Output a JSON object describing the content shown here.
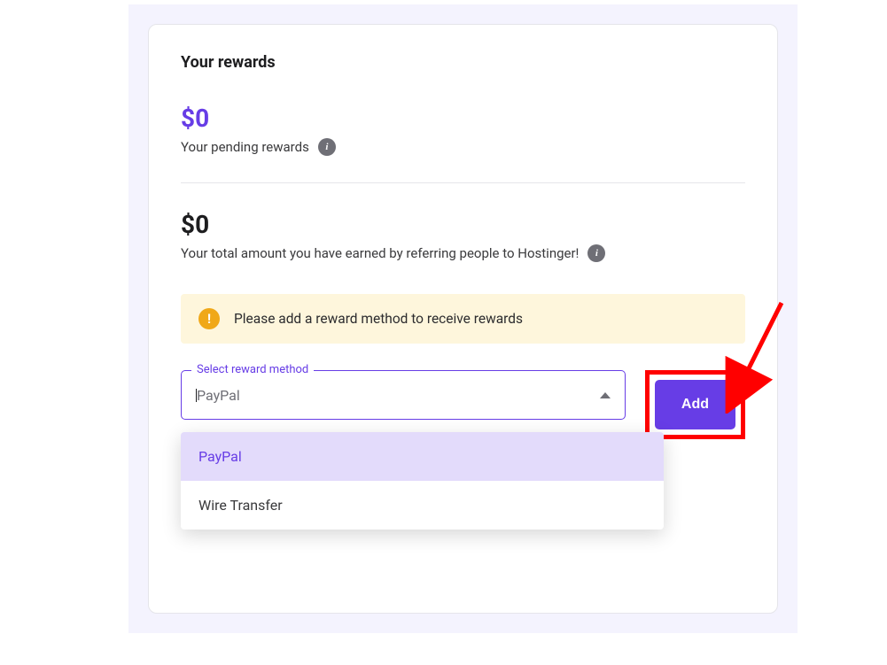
{
  "heading": "Your rewards",
  "pending": {
    "amount": "$0",
    "label": "Your pending rewards"
  },
  "total": {
    "amount": "$0",
    "label": "Your total amount you have earned by referring people to Hostinger!"
  },
  "alert": {
    "icon_text": "!",
    "text": "Please add a reward method to receive rewards"
  },
  "select": {
    "label": "Select reward method",
    "value": "PayPal",
    "options": [
      "PayPal",
      "Wire Transfer"
    ]
  },
  "add_button_label": "Add",
  "info_glyph": "i"
}
